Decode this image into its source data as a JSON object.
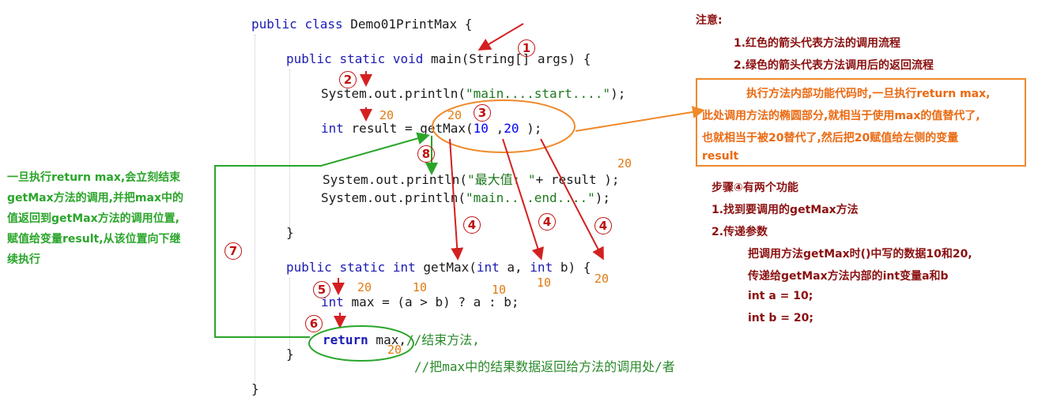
{
  "code": {
    "line1_public": "public",
    "line1_class": "class",
    "line1_name": "Demo01PrintMax {",
    "main_public": "public",
    "main_static": "static",
    "main_void": "void",
    "main_sig": "main(String[] args) {",
    "println_start": "System.out.println(",
    "println_start_str": "\"main....start....\"",
    "println_start_end": ");",
    "result_int": "int",
    "result_rest": "result = getMax(",
    "result_arg1": "10",
    "result_comma": " ,",
    "result_arg2": "20",
    "result_close": " );",
    "println_max": "System.out.println(",
    "println_max_str": "\"最大值: \"",
    "println_max_end": "+ result );",
    "println_end": "System.out.println(",
    "println_end_str": "\"main....end....\"",
    "println_end_close": ");",
    "close_main": "}",
    "getmax_public": "public",
    "getmax_static": "static",
    "getmax_int": "int",
    "getmax_name": "getMax(",
    "getmax_int_a": "int",
    "getmax_a": " a, ",
    "getmax_int_b": "int",
    "getmax_b": " b) {",
    "max_int": "int",
    "max_rest": "max = (a > b) ? a : b;",
    "return_kw": "return",
    "return_rest": " max,",
    "comment1": "//结束方法,",
    "comment2": "//把max中的结果数据返回给方法的调用处/者",
    "close_getmax": "}",
    "close_class": "}"
  },
  "annotations": {
    "v20_result": "20",
    "v20_getmax": "20",
    "v20_println": "20",
    "v20_max": "20",
    "v10_max_a": "10",
    "v10_cond_a": "10",
    "v10_param_a": "10",
    "v20_param_b": "20",
    "v20_return": "20"
  },
  "steps": {
    "s1": "1",
    "s2": "2",
    "s3": "3",
    "s4a": "4",
    "s4b": "4",
    "s4c": "4",
    "s5": "5",
    "s6": "6",
    "s7": "7",
    "s8": "8"
  },
  "notes": {
    "title": "注意:",
    "line1": "1.红色的箭头代表方法的调用流程",
    "line2": "2.绿色的箭头代表方法调用后的返回流程"
  },
  "orange_box": {
    "line1": "执行方法内部功能代码时,一旦执行return max,",
    "line2": "此处调用方法的椭圆部分,就相当于使用max的值替代了,",
    "line3": "也就相当于被20替代了,然后把20赋值给左侧的变量",
    "line4": "result"
  },
  "step4_note": {
    "title": "步骤④有两个功能",
    "line1": "1.找到要调用的getMax方法",
    "line2": "2.传递参数",
    "line3": "把调用方法getMax时()中写的数据10和20,",
    "line4": "传递给getMax方法内部的int变量a和b",
    "line5": "int a = 10;",
    "line6": "int b = 20;"
  },
  "green_note": {
    "line1": "一旦执行return max,会立刻结束",
    "line2": "getMax方法的调用,并把max中的",
    "line3": "值返回到getMax方法的调用位置,",
    "line4": "赋值给变量result,从该位置向下继",
    "line5": "续执行"
  },
  "colors": {
    "call_flow": "#d42020",
    "return_flow": "#2aa52a",
    "highlight": "#f0892a"
  }
}
